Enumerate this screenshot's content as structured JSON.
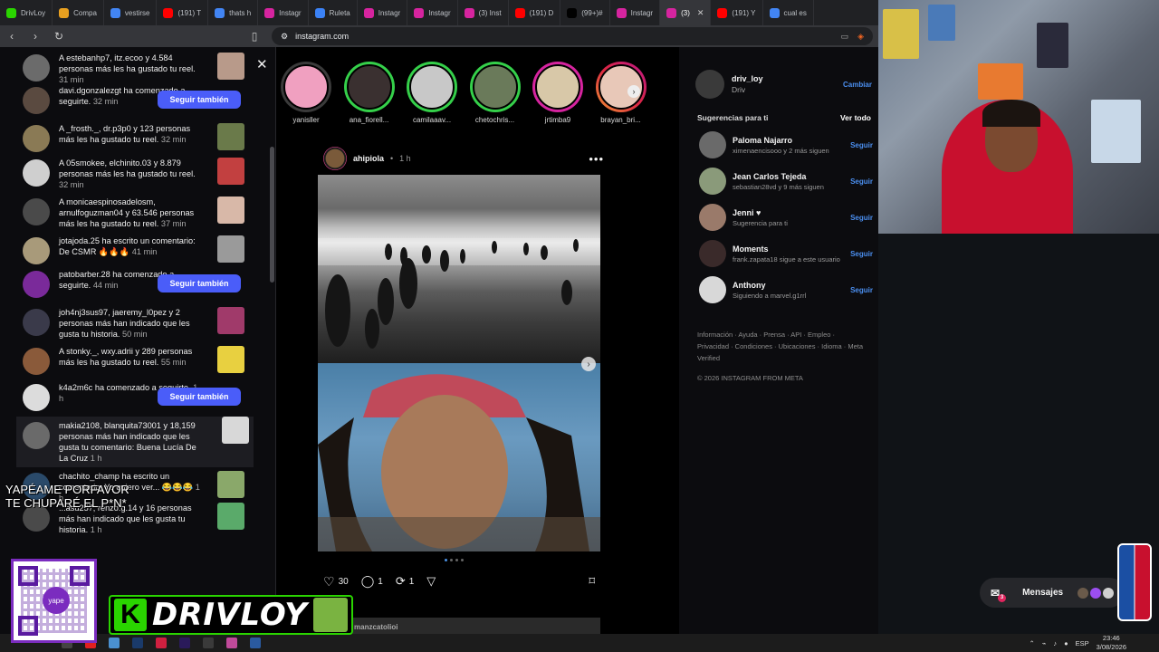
{
  "browser": {
    "tabs": [
      {
        "label": "DrivLoy",
        "color": "#2ad400"
      },
      {
        "label": "Compa",
        "color": "#e8a020"
      },
      {
        "label": "vestirse",
        "color": "#4285f4"
      },
      {
        "label": "(191) T",
        "color": "#ff0000"
      },
      {
        "label": "thats h",
        "color": "#4285f4"
      },
      {
        "label": "Instagr",
        "color": "#d6249f"
      },
      {
        "label": "Ruleta",
        "color": "#3b82f6"
      },
      {
        "label": "Instagr",
        "color": "#d6249f"
      },
      {
        "label": "Instagr",
        "color": "#d6249f"
      },
      {
        "label": "(3) Inst",
        "color": "#d6249f"
      },
      {
        "label": "(191) D",
        "color": "#ff0000"
      },
      {
        "label": "(99+)#",
        "color": "#010101"
      },
      {
        "label": "Instagr",
        "color": "#d6249f"
      },
      {
        "label": "(3)",
        "color": "#d6249f",
        "active": true
      },
      {
        "label": "(191) Y",
        "color": "#ff0000"
      },
      {
        "label": "cual es",
        "color": "#4285f4"
      }
    ],
    "url": "instagram.com"
  },
  "notifications": [
    {
      "text": "A estebanhp7, itz.ecoo y 4.584 personas más les ha gustado tu reel.",
      "time": "31 min",
      "avatar": "#6b6b6b",
      "thumb": "#b89a8a"
    },
    {
      "text": "davi.dgonzalezgt ha comenzado a seguirte.",
      "time": "32 min",
      "avatar": "#5a4a40",
      "button": "Seguir también"
    },
    {
      "text": "A _frosth._, dr.p3p0 y 123 personas más les ha gustado tu reel.",
      "time": "32 min",
      "avatar": "#8a7a55",
      "thumb": "#6a7a4a"
    },
    {
      "text": "A 05smokee, elchinito.03 y 8.879 personas más les ha gustado tu reel.",
      "time": "32 min",
      "avatar": "#cfcfcf",
      "thumb": "#c24040"
    },
    {
      "text": "A monicaespinosadelosm, arnulfoguzman04 y 63.546 personas más les ha gustado tu reel.",
      "time": "37 min",
      "avatar": "#4a4a4a",
      "thumb": "#d8b8a8"
    },
    {
      "text": "jotajoda.25 ha escrito un comentario: De CSMR 🔥🔥🔥",
      "time": "41 min",
      "avatar": "#a89a7a",
      "thumb": "#9a9a9a"
    },
    {
      "text": "patobarber.28 ha comenzado a seguirte.",
      "time": "44 min",
      "avatar": "#7a2a9a",
      "button": "Seguir también"
    },
    {
      "text": "joh4nj3sus97, jaeremy_l0pez y 2 personas más han indicado que les gusta tu historia.",
      "time": "50 min",
      "avatar": "#3a3a4a",
      "thumb": "#a03a6a"
    },
    {
      "text": "A stonky._, wxy.adrii y 289 personas más les ha gustado tu reel.",
      "time": "55 min",
      "avatar": "#8a5a3a",
      "thumb": "#e8d040"
    },
    {
      "text": "k4a2m6c ha comenzado a seguirte.",
      "time": "1 h",
      "avatar": "#dcdcdc",
      "button": "Seguir también"
    },
    {
      "text": "makia2108, blanquita73001 y 18,159 personas más han indicado que les gusta tu comentario: Buena Lucía De La Cruz",
      "time": "1 h",
      "avatar": "#6a6a6a",
      "thumb": "#d8d8d8",
      "highlight": true
    },
    {
      "text": "chachito_champ ha escrito un comentario: Yo quiero ver... 😂😂😂",
      "time": "1 h",
      "avatar": "#2a4a6a",
      "thumb": "#8aa86a"
    },
    {
      "text": "...asu257, renzo.g.14 y 16 personas más han indicado que les gusta tu historia.",
      "time": "1 h",
      "avatar": "#4a4a4a",
      "thumb": "#5aaa6a"
    }
  ],
  "feed": {
    "stories": [
      {
        "name": "yanisller",
        "ring": "#3a3a3a",
        "color": "#f0a0c0"
      },
      {
        "name": "ana_fiorell...",
        "ring": "#35d04a",
        "color": "#3a3030"
      },
      {
        "name": "camilaaav...",
        "ring": "#35d04a",
        "color": "#c8c8c8"
      },
      {
        "name": "chetochris...",
        "ring": "#35d04a",
        "color": "#6a7a5a"
      },
      {
        "name": "jrtimba9",
        "ring": "#d6249f",
        "color": "#d8c8a8"
      },
      {
        "name": "brayan_bri...",
        "ring": "#f09433",
        "color": "#e8c8b8"
      }
    ],
    "post": {
      "user": "ahipiola",
      "time": "1 h",
      "likes": "30",
      "comments": "1",
      "reposts": "1",
      "dots": 4
    },
    "next_post_user": "manzcatolioi"
  },
  "sidebar": {
    "me": {
      "username": "driv_loy",
      "name": "Driv",
      "switch": "Cambiar"
    },
    "suggestions_title": "Sugerencias para ti",
    "see_all": "Ver todo",
    "follow_label": "Seguir",
    "suggestions": [
      {
        "name": "Paloma Najarro",
        "desc": "ximenaencisooo y 2 más siguen",
        "color": "#6a6a6a"
      },
      {
        "name": "Jean Carlos Tejeda",
        "desc": "sebastian28vd y 9 más siguen",
        "color": "#8a9a7a"
      },
      {
        "name": "Jenni ♥",
        "desc": "Sugerencia para ti",
        "color": "#9a7a6a"
      },
      {
        "name": "Moments",
        "desc": "frank.zapata18 sigue a este usuario",
        "color": "#3a2a2a"
      },
      {
        "name": "Anthony",
        "desc": "Siguiendo a marvel.g1rrl",
        "color": "#d8d8d8"
      }
    ],
    "links": "Información · Ayuda · Prensa · API · Empleo · Privacidad · Condiciones · Ubicaciones · Idioma · Meta Verified",
    "copyright": "© 2026 INSTAGRAM FROM META"
  },
  "messages_label": "Mensajes",
  "overlay": {
    "tts_text": "YAPÉAME PORFAVOR\nTE CHUPARÉ EL P*N*",
    "brand_letter": "K",
    "brand_name": "DRIVLOY",
    "qr_label": "yape"
  },
  "taskbar": {
    "lang": "ESP",
    "time": "23:46",
    "date": "3/08/2026"
  }
}
